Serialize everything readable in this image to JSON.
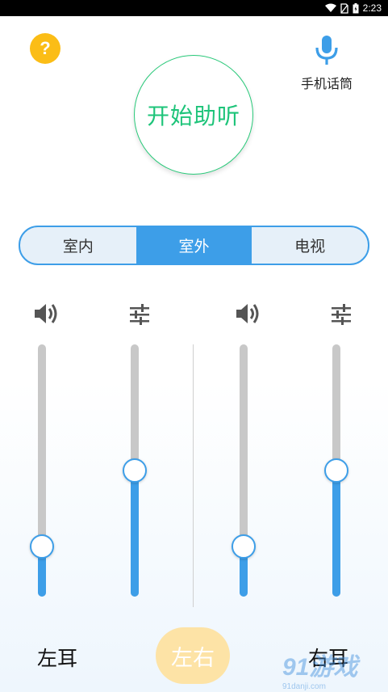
{
  "status_bar": {
    "time": "2:23",
    "icons": [
      "wifi-icon",
      "no-sim-icon",
      "battery-icon"
    ]
  },
  "help_button": {
    "label": "?",
    "color": "#fbbd16"
  },
  "mic": {
    "label": "手机话筒",
    "icon": "microphone-icon",
    "color": "#3d9ee8"
  },
  "start_button": {
    "label": "开始助听",
    "color": "#1ec47a"
  },
  "modes": {
    "tabs": [
      {
        "label": "室内",
        "active": false
      },
      {
        "label": "室外",
        "active": true
      },
      {
        "label": "电视",
        "active": false
      }
    ],
    "accent": "#3d9ee8"
  },
  "sliders": {
    "left_volume": {
      "icon": "volume-icon",
      "level": 0.2
    },
    "left_tuning": {
      "icon": "equalizer-icon",
      "level": 0.5
    },
    "right_volume": {
      "icon": "volume-icon",
      "level": 0.2
    },
    "right_tuning": {
      "icon": "equalizer-icon",
      "level": 0.5
    }
  },
  "labels": {
    "left_ear": "左耳",
    "right_ear": "右耳",
    "switch": "左右"
  },
  "watermark": {
    "logo": "91游戏",
    "sub": "91danji.com"
  }
}
